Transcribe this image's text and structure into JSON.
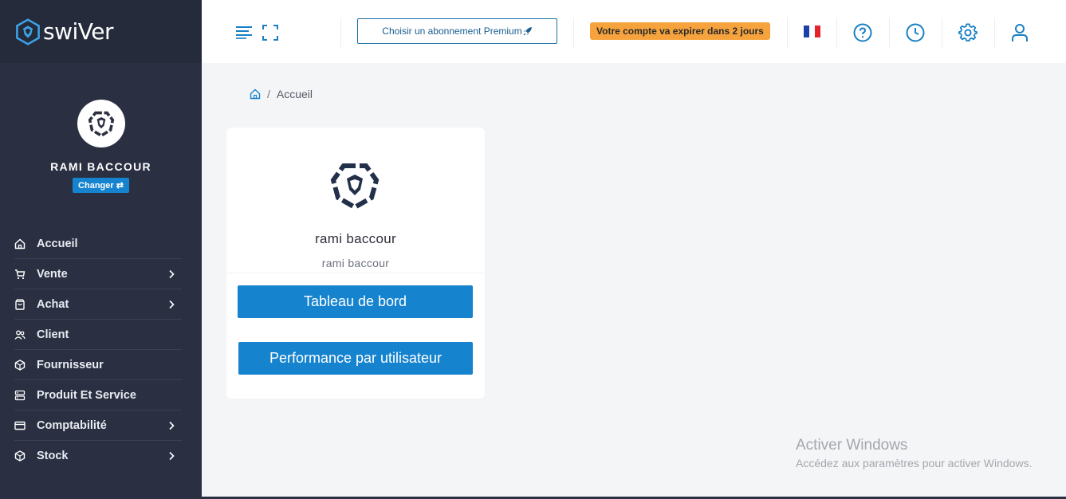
{
  "brand": {
    "name": "swiVer"
  },
  "profile": {
    "name": "RAMI BACCOUR",
    "change_label": "Changer ⇄"
  },
  "menu": [
    {
      "label": "Accueil",
      "icon": "home-icon",
      "has_submenu": false
    },
    {
      "label": "Vente",
      "icon": "cart-icon",
      "has_submenu": true
    },
    {
      "label": "Achat",
      "icon": "bag-icon",
      "has_submenu": true
    },
    {
      "label": "Client",
      "icon": "users-icon",
      "has_submenu": false
    },
    {
      "label": "Fournisseur",
      "icon": "box-icon",
      "has_submenu": false
    },
    {
      "label": "Produit Et Service",
      "icon": "server-icon",
      "has_submenu": false
    },
    {
      "label": "Comptabilité",
      "icon": "card-icon",
      "has_submenu": true
    },
    {
      "label": "Stock",
      "icon": "cube-icon",
      "has_submenu": true
    }
  ],
  "header": {
    "premium_label": "Choisir un abonnement Premium",
    "expire_label": "Votre compte va expirer dans 2 jours",
    "language": "fr"
  },
  "breadcrumb": {
    "current": "Accueil"
  },
  "card": {
    "title": "rami baccour",
    "subtitle": "rami baccour",
    "button1": "Tableau de bord",
    "button2": "Performance par utilisateur"
  },
  "watermark": {
    "line1": "Activer Windows",
    "line2": "Accédez aux paramètres pour activer Windows."
  },
  "colors": {
    "sidebar": "#2a3042",
    "accent": "#1683cf",
    "badge": "#f6a33d",
    "icon_blue": "#1a7fc4"
  }
}
